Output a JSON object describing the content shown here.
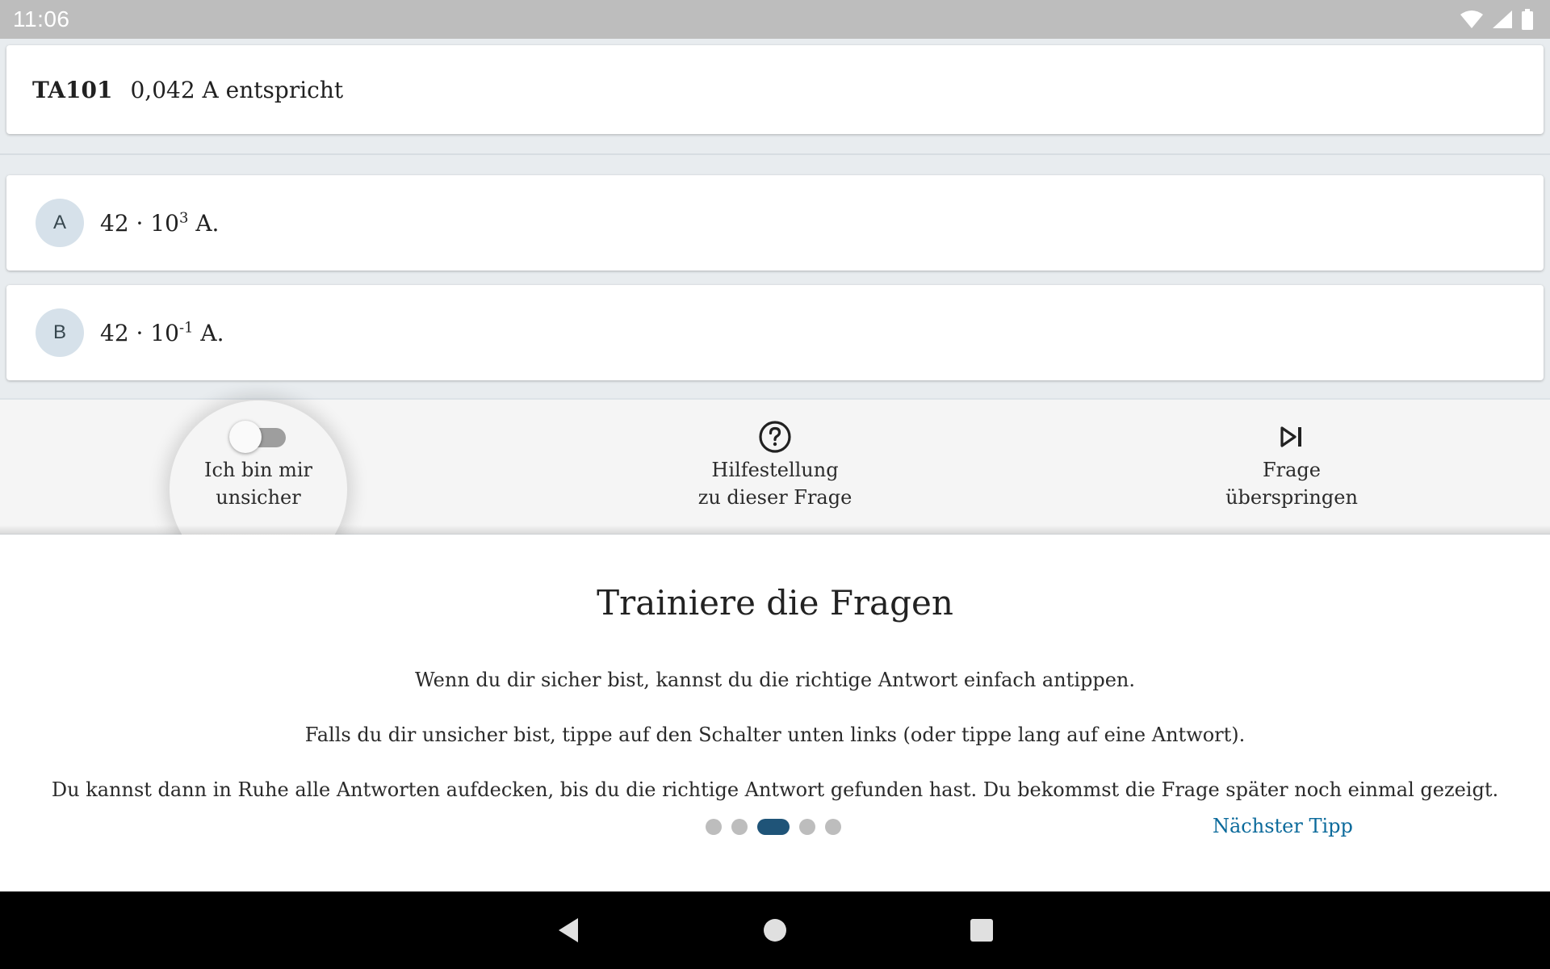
{
  "status_bar": {
    "time": "11:06",
    "icons": [
      "wifi-icon",
      "signal-icon",
      "battery-icon"
    ]
  },
  "question": {
    "id": "TA101",
    "text": "0,042 A entspricht"
  },
  "answers": [
    {
      "letter": "A",
      "mantissa": "42 · 10",
      "exponent": "3",
      "unit": " A."
    },
    {
      "letter": "B",
      "mantissa": "42 · 10",
      "exponent": "-1",
      "unit": " A."
    }
  ],
  "actions": {
    "unsure": {
      "line1": "Ich bin mir",
      "line2": "unsicher",
      "toggle_on": false
    },
    "help": {
      "line1": "Hilfestellung",
      "line2": "zu dieser Frage",
      "icon": "help-circle-icon"
    },
    "skip": {
      "line1": "Frage",
      "line2": "überspringen",
      "icon": "skip-next-icon"
    }
  },
  "tip": {
    "title": "Trainiere die Fragen",
    "paragraphs": [
      "Wenn du dir sicher bist, kannst du die richtige Antwort einfach antippen.",
      "Falls du dir unsicher bist, tippe auf den Schalter unten links (oder tippe lang auf eine Antwort).",
      "Du kannst dann in Ruhe alle Antworten aufdecken, bis du die richtige Antwort gefunden hast. Du bekommst die Frage später noch einmal gezeigt."
    ],
    "pager": {
      "total": 5,
      "current": 3
    },
    "next_label": "Nächster Tipp"
  },
  "colors": {
    "accent": "#1f5478",
    "link": "#0b6a9b",
    "answer_badge": "#d6e1ea",
    "background": "#e8ecef"
  },
  "nav": [
    "back-icon",
    "home-icon",
    "recents-icon"
  ]
}
